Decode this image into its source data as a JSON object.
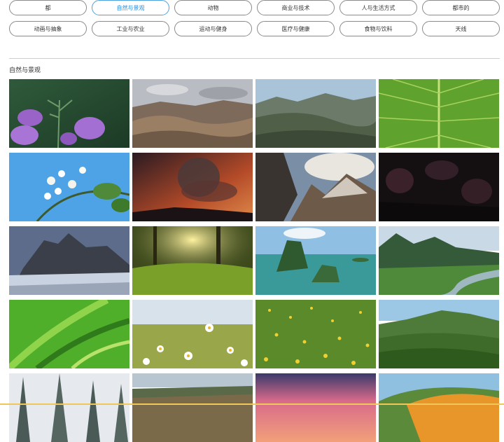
{
  "categories": [
    {
      "label": "都",
      "active": false
    },
    {
      "label": "自然与景观",
      "active": true
    },
    {
      "label": "动物",
      "active": false
    },
    {
      "label": "商业与技术",
      "active": false
    },
    {
      "label": "人与生活方式",
      "active": false
    },
    {
      "label": "都市的",
      "active": false
    },
    {
      "label": "动画与抽象",
      "active": false
    },
    {
      "label": "工业与农业",
      "active": false
    },
    {
      "label": "运动与健身",
      "active": false
    },
    {
      "label": "医疗与健康",
      "active": false
    },
    {
      "label": "食物与饮料",
      "active": false
    },
    {
      "label": "天线",
      "active": false
    }
  ],
  "section": {
    "title": "自然与景观"
  },
  "thumbnails": [
    {
      "name": "thumb-purple-flowers"
    },
    {
      "name": "thumb-desert-hills"
    },
    {
      "name": "thumb-mountain-valley"
    },
    {
      "name": "thumb-green-leaf"
    },
    {
      "name": "thumb-white-blossoms"
    },
    {
      "name": "thumb-volcano-eruption"
    },
    {
      "name": "thumb-cloudy-peaks"
    },
    {
      "name": "thumb-aurora-night"
    },
    {
      "name": "thumb-snowy-dolomites"
    },
    {
      "name": "thumb-sunlit-forest"
    },
    {
      "name": "thumb-island-rocks"
    },
    {
      "name": "thumb-river-mountains"
    },
    {
      "name": "thumb-grass-blades"
    },
    {
      "name": "thumb-daisy-field"
    },
    {
      "name": "thumb-yellow-meadow"
    },
    {
      "name": "thumb-green-valley"
    },
    {
      "name": "thumb-snowy-pines"
    },
    {
      "name": "thumb-hill-forest"
    },
    {
      "name": "thumb-pink-sunset"
    },
    {
      "name": "thumb-orange-flower-hill"
    }
  ]
}
